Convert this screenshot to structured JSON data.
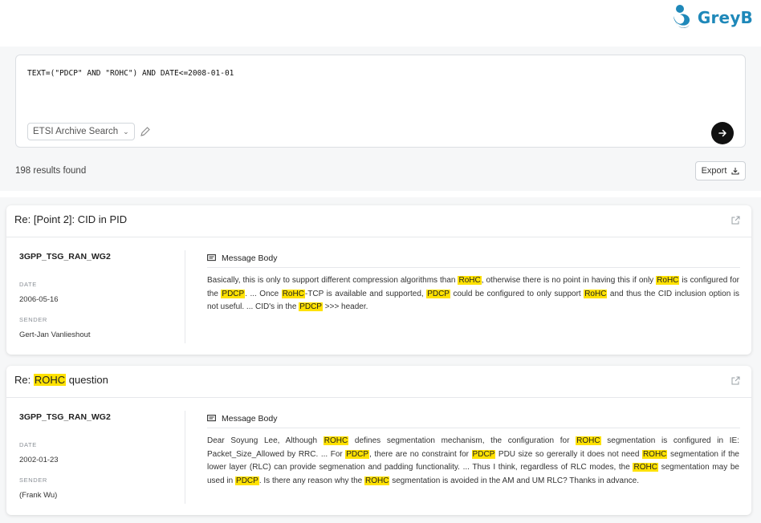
{
  "brand": {
    "name": "GreyB",
    "color": "#1e88b9"
  },
  "search": {
    "query": "TEXT=(\"PDCP\" AND \"ROHC\") AND DATE<=2008-01-01",
    "source": "ETSI Archive Search"
  },
  "results_count": "198 results found",
  "export_label": "Export",
  "icons": [
    "logo-icon",
    "chevron-down-icon",
    "pen-icon",
    "arrow-right-icon",
    "download-icon",
    "external-link-icon",
    "message-icon"
  ],
  "results": [
    {
      "title_segments": [
        {
          "text": "Re: [Point 2]: CID in PID",
          "hl": false
        }
      ],
      "group": "3GPP_TSG_RAN_WG2",
      "date_label": "DATE",
      "date": "2006-05-16",
      "sender_label": "SENDER",
      "sender": "Gert-Jan Vanlieshout",
      "tab_label": "Message Body",
      "body_segments": [
        {
          "text": "Basically, this is only to support different compression algorithms than ",
          "hl": false
        },
        {
          "text": "RoHC",
          "hl": true
        },
        {
          "text": ", otherwise there is no point in having this if only ",
          "hl": false
        },
        {
          "text": "RoHC",
          "hl": true
        },
        {
          "text": " is configured for the ",
          "hl": false
        },
        {
          "text": "PDCP",
          "hl": true
        },
        {
          "text": ". ... Once ",
          "hl": false
        },
        {
          "text": "RoHC",
          "hl": true
        },
        {
          "text": "-TCP is available and supported, ",
          "hl": false
        },
        {
          "text": "PDCP",
          "hl": true
        },
        {
          "text": " could be configured to only support ",
          "hl": false
        },
        {
          "text": "RoHC",
          "hl": true
        },
        {
          "text": " and thus the CID inclusion option is not useful. ... CID's in the ",
          "hl": false
        },
        {
          "text": "PDCP",
          "hl": true
        },
        {
          "text": " >>> header.",
          "hl": false
        }
      ]
    },
    {
      "title_segments": [
        {
          "text": "Re: ",
          "hl": false
        },
        {
          "text": "ROHC",
          "hl": true
        },
        {
          "text": " question",
          "hl": false
        }
      ],
      "group": "3GPP_TSG_RAN_WG2",
      "date_label": "DATE",
      "date": "2002-01-23",
      "sender_label": "SENDER",
      "sender": "(Frank Wu)",
      "tab_label": "Message Body",
      "body_segments": [
        {
          "text": "Dear Soyung Lee, Although ",
          "hl": false
        },
        {
          "text": "ROHC",
          "hl": true
        },
        {
          "text": " defines segmentation mechanism, the configuration for ",
          "hl": false
        },
        {
          "text": "ROHC",
          "hl": true
        },
        {
          "text": " segmentation is configured in IE: Packet_Size_Allowed by RRC. ... For ",
          "hl": false
        },
        {
          "text": "PDCP",
          "hl": true
        },
        {
          "text": ", there are no constraint for ",
          "hl": false
        },
        {
          "text": "PDCP",
          "hl": true
        },
        {
          "text": " PDU size so gererally it does not need ",
          "hl": false
        },
        {
          "text": "ROHC",
          "hl": true
        },
        {
          "text": " segmentation if the lower layer (RLC) can provide segmenation and padding functionality. ... Thus I think, regardless of RLC modes, the ",
          "hl": false
        },
        {
          "text": "ROHC",
          "hl": true
        },
        {
          "text": " segmentation may be used in ",
          "hl": false
        },
        {
          "text": "PDCP",
          "hl": true
        },
        {
          "text": ". Is there any reason why the ",
          "hl": false
        },
        {
          "text": "ROHC",
          "hl": true
        },
        {
          "text": " segmentation is avoided in the AM and UM RLC? Thanks in advance.",
          "hl": false
        }
      ]
    }
  ]
}
